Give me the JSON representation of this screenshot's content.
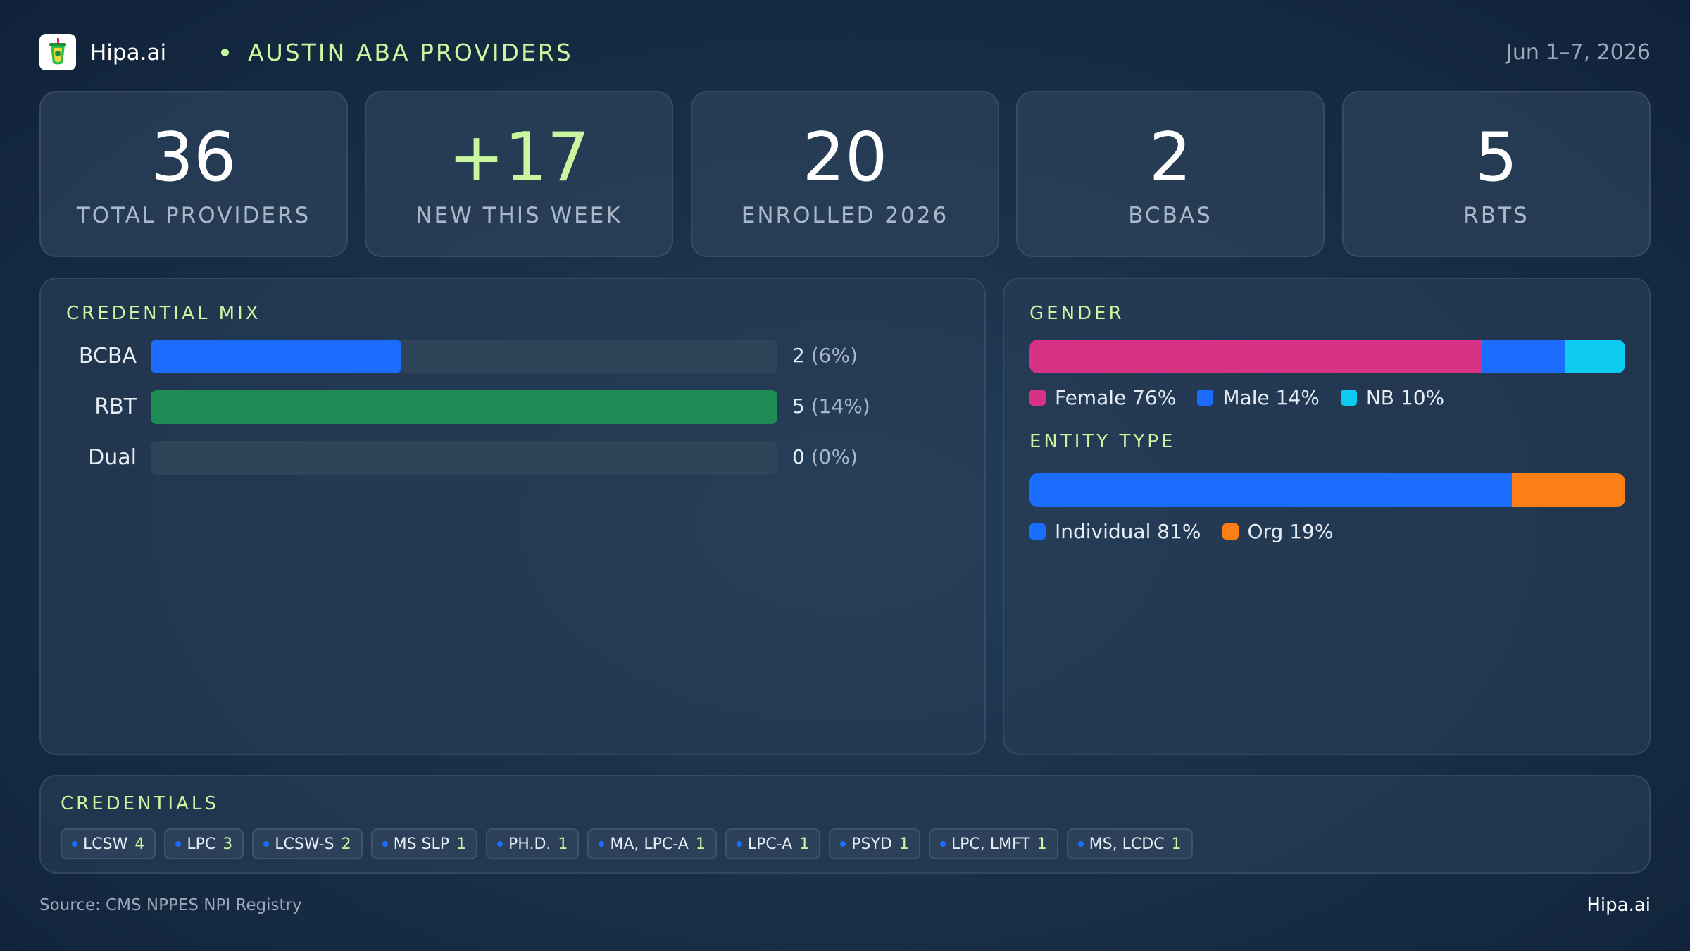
{
  "header": {
    "brand": "Hipa.ai",
    "title": "AUSTIN ABA PROVIDERS",
    "date": "Jun 1–7, 2026",
    "logo_icon": "cup-icon"
  },
  "stats": [
    {
      "value": "36",
      "label": "TOTAL PROVIDERS"
    },
    {
      "value": "+17",
      "label": "NEW THIS WEEK",
      "accent": "#c8f7a0"
    },
    {
      "value": "20",
      "label": "ENROLLED 2026"
    },
    {
      "value": "2",
      "label": "BCBAS"
    },
    {
      "value": "5",
      "label": "RBTS"
    }
  ],
  "credential_mix": {
    "title": "CREDENTIAL MIX",
    "rows": [
      {
        "label": "BCBA",
        "value": "2",
        "pct": "(6%)",
        "fraction": 0.4,
        "color": "#1a6dff"
      },
      {
        "label": "RBT",
        "value": "5",
        "pct": "(14%)",
        "fraction": 1.0,
        "color": "#1e8c55"
      },
      {
        "label": "Dual",
        "value": "0",
        "pct": "(0%)",
        "fraction": 0.0,
        "color": "#2f4359"
      }
    ]
  },
  "gender": {
    "title": "GENDER",
    "segments": [
      {
        "label": "Female 76%",
        "percent": 76,
        "color": "#d63384"
      },
      {
        "label": "Male 14%",
        "percent": 14,
        "color": "#1a6dff"
      },
      {
        "label": "NB 10%",
        "percent": 10,
        "color": "#0dcaf0"
      }
    ]
  },
  "entity_type": {
    "title": "ENTITY TYPE",
    "segments": [
      {
        "label": "Individual 81%",
        "percent": 81,
        "color": "#1a6dff"
      },
      {
        "label": "Org 19%",
        "percent": 19,
        "color": "#fd7e14"
      }
    ]
  },
  "credentials": {
    "title": "CREDENTIALS",
    "chips": [
      {
        "name": "LCSW",
        "count": "4"
      },
      {
        "name": "LPC",
        "count": "3"
      },
      {
        "name": "LCSW-S",
        "count": "2"
      },
      {
        "name": "MS SLP",
        "count": "1"
      },
      {
        "name": "PH.D.",
        "count": "1"
      },
      {
        "name": "MA, LPC-A",
        "count": "1"
      },
      {
        "name": "LPC-A",
        "count": "1"
      },
      {
        "name": "PSYD",
        "count": "1"
      },
      {
        "name": "LPC, LMFT",
        "count": "1"
      },
      {
        "name": "MS, LCDC",
        "count": "1"
      }
    ]
  },
  "footer": {
    "source": "Source: CMS NPPES NPI Registry",
    "brand": "Hipa.ai"
  }
}
